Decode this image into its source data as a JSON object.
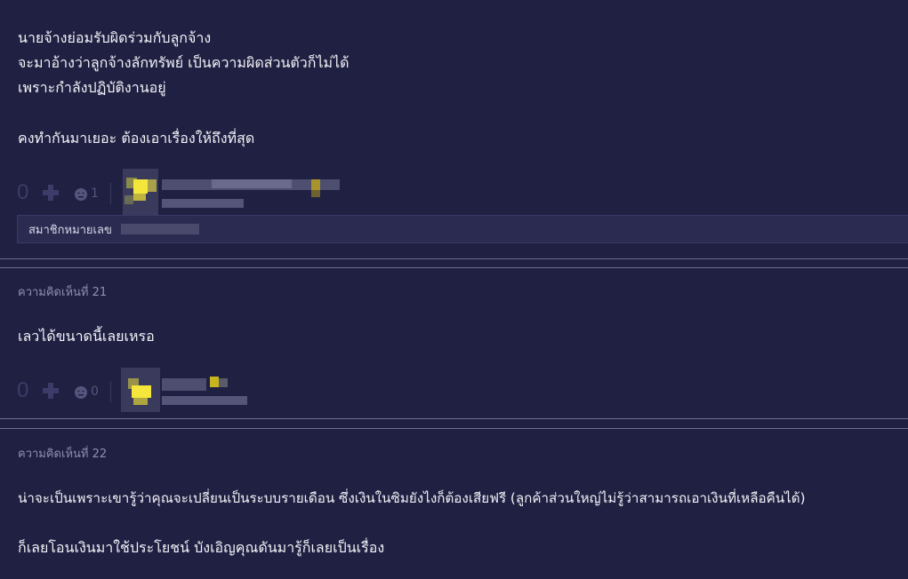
{
  "comment20": {
    "lines": [
      "นายจ้างย่อมรับผิดร่วมกับลูกจ้าง",
      "จะมาอ้างว่าลูกจ้างลักทรัพย์ เป็นความผิดส่วนตัวก็ไม่ได้",
      "เพราะกำลังปฏิบัติงานอยู่",
      "คงทำกันมาเยอะ ต้องเอาเรื่องให้ถึงที่สุด"
    ],
    "votes": "0",
    "emotion_count": "1",
    "member_label": "สมาชิกหมายเลข"
  },
  "comment21": {
    "number_label": "ความคิดเห็นที่ 21",
    "text": "เลวได้ขนาดนี้เลยเหรอ",
    "votes": "0",
    "emotion_count": "0"
  },
  "comment22": {
    "number_label": "ความคิดเห็นที่ 22",
    "line1": "น่าจะเป็นเพราะเขารู้ว่าคุณจะเปลี่ยนเป็นระบบรายเดือน ซึ่งเงินในซิมยังไงก็ต้องเสียฟรี (ลูกค้าส่วนใหญ่ไม่รู้ว่าสามารถเอาเงินที่เหลือคืนได้)",
    "line2": "ก็เลยโอนเงินมาใช้ประโยชน์ บังเอิญคุณดันมารู้ก็เลยเป็นเรื่อง"
  },
  "colors": {
    "background": "#202043",
    "text": "#f2f2f7",
    "muted": "#8f8fb0",
    "divider": "#6d6d95"
  },
  "icons": [
    "plus-icon",
    "emotion-icon",
    "avatar-pixelated"
  ]
}
